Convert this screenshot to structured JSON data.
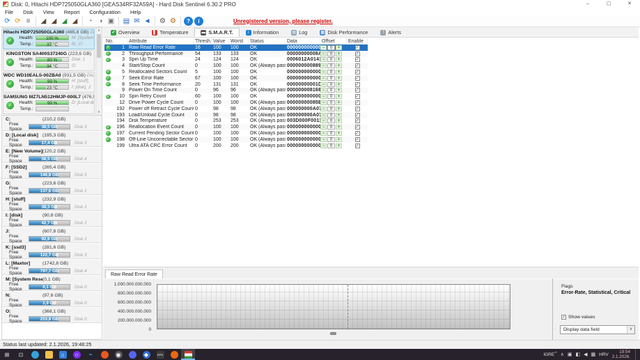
{
  "window": {
    "title": "Disk: 0, Hitachi HDP725050GLA360 [GEAS34RF32A59A]  -  Hard Disk Sentinel 6.30.2 PRO",
    "controls": [
      {
        "name": "minimize",
        "glyph": "–"
      },
      {
        "name": "maximize",
        "glyph": "▢"
      },
      {
        "name": "close",
        "glyph": "✕"
      }
    ]
  },
  "menu": [
    "File",
    "Disk",
    "View",
    "Report",
    "Configuration",
    "Help"
  ],
  "toolbar": {
    "register_notice": "Unregistered version, please register.",
    "icons": [
      {
        "name": "refresh-icon",
        "glyph": "⟳",
        "color": "#1d7fd6"
      },
      {
        "name": "refresh-all-icon",
        "glyph": "⟳",
        "color": "#e8920c"
      },
      {
        "name": "surface-list-icon",
        "glyph": "≡",
        "color": "#666"
      },
      {
        "name": "drive-rescan-icon",
        "glyph": "◢",
        "color": "#5a4632"
      },
      {
        "name": "drive-remove-icon",
        "glyph": "◢",
        "color": "#5a4632"
      },
      {
        "name": "drive-accept-icon",
        "glyph": "◢",
        "color": "#2f8a3a"
      },
      {
        "name": "drive-search-icon",
        "glyph": "◢",
        "color": "#5a4632"
      },
      {
        "name": "disk-clock-icon",
        "glyph": "◔",
        "color": "#5b7d99"
      },
      {
        "name": "disk-status-icon",
        "glyph": "◑",
        "color": "#5b7d99"
      },
      {
        "name": "printer-icon",
        "glyph": "▣",
        "color": "#777777"
      },
      {
        "name": "report-notebook-icon",
        "glyph": "▤",
        "color": "#2f6fbf"
      },
      {
        "name": "mail-icon",
        "glyph": "✉",
        "color": "#2f6fbf"
      },
      {
        "name": "message-icon",
        "glyph": "◄",
        "color": "#2f6fbf"
      },
      {
        "name": "settings-gear-icon",
        "glyph": "⚙",
        "color": "#555555"
      },
      {
        "name": "advanced-gear-icon",
        "glyph": "⚙",
        "color": "#b06a10"
      },
      {
        "name": "help-icon",
        "glyph": "?",
        "color": "#1d7fd6",
        "circle": true
      },
      {
        "name": "info-icon",
        "glyph": "i",
        "color": "#1d7fd6",
        "circle": true
      }
    ]
  },
  "sidebar": {
    "health_label": "Health:",
    "temp_label": "Temp.:",
    "free_space_label": "Free Space",
    "scroll_up": "∧",
    "scroll_down": "∨",
    "status_check": "✓",
    "disks": [
      {
        "name": "Hitachi HDP725050GLA360",
        "size": "(465,8 GB)",
        "disk_label": "Disk 0",
        "health": "100 %",
        "health_fill": 100,
        "temp": "37 °C",
        "temp_fill": 50,
        "right1": "M: [System Rese",
        "right2": "N:, O:",
        "selected": true
      },
      {
        "name": "KINGSTON SA400S37240G",
        "size": "(223,6 GB)",
        "disk_label": "",
        "health": "80 %",
        "health_fill": 80,
        "temp": "34 °C",
        "temp_fill": 45,
        "right1": "Disk: 1",
        "right2": "G:",
        "selected": false
      },
      {
        "name": "WDC WD10EALS-00ZBA0",
        "size": "(931,5 GB)",
        "disk_label": "Disk 2",
        "health": "99 %",
        "health_fill": 99,
        "temp": "23 °C",
        "temp_fill": 31,
        "right1": "H: [stuff],",
        "right2": "I: [disk], J:",
        "selected": false
      },
      {
        "name": "SAMSUNG MZ7LN512HMJP-000L7",
        "size": "(476,9 GB)",
        "disk_label": "",
        "health": "99 %",
        "health_fill": 99,
        "temp": "",
        "temp_fill": 0,
        "right1": "D: [Local disk]",
        "right2": "",
        "selected": false
      }
    ],
    "partitions": [
      {
        "letter": "C:",
        "size": "(210,2 GB)",
        "free": "38,5 GB",
        "fill": 67,
        "disk": "Disk 3"
      },
      {
        "letter": "D: [Local disk]",
        "size": "(195,3 GB)",
        "free": "17,4 GB",
        "fill": 62,
        "disk": "Disk 3"
      },
      {
        "letter": "E: [New Volume]",
        "size": "(120,2 GB)",
        "free": "58,5 GB",
        "fill": 67,
        "disk": "Disk 4"
      },
      {
        "letter": "F: [SSD2]",
        "size": "(265,4 GB)",
        "free": "146,8 GB",
        "fill": 72,
        "disk": "Disk 5"
      },
      {
        "letter": "G:",
        "size": "(223,6 GB)",
        "free": "137,6 GB",
        "fill": 72,
        "disk": "Disk 1"
      },
      {
        "letter": "H: [stuff]",
        "size": "(232,9 GB)",
        "free": "38,3 GB",
        "fill": 62,
        "disk": "Disk 2"
      },
      {
        "letter": "I: [disk]",
        "size": "(90,8 GB)",
        "free": "42,7 GB",
        "fill": 60,
        "disk": "Disk 2"
      },
      {
        "letter": "J:",
        "size": "(607,8 GB)",
        "free": "92,6 GB",
        "fill": 68,
        "disk": "Disk 2"
      },
      {
        "letter": "K: [ssd3]",
        "size": "(281,6 GB)",
        "free": "122,7 GB",
        "fill": 68,
        "disk": "Disk 3"
      },
      {
        "letter": "L: [Maxtor]",
        "size": "(1742,8 GB)",
        "free": "797,7 GB",
        "fill": 70,
        "disk": "Disk 4"
      },
      {
        "letter": "M: [System Rese...]",
        "size": "(0,1 GB)",
        "free": "0,1 GB",
        "fill": 55,
        "disk": "Disk 0"
      },
      {
        "letter": "N:",
        "size": "(97,6 GB)",
        "free": "1,9 GB",
        "fill": 55,
        "disk": "Disk 0"
      },
      {
        "letter": "O:",
        "size": "(368,1 GB)",
        "free": "253,8 GB",
        "fill": 73,
        "disk": "Disk 0"
      }
    ]
  },
  "tabs": [
    {
      "label": "Overview",
      "icon": "check-circle-icon",
      "glyph": "✔",
      "color": "#2daa3f",
      "active": false
    },
    {
      "label": "Temperature",
      "icon": "thermometer-icon",
      "glyph": "▌",
      "color": "#d23b2e",
      "active": false
    },
    {
      "label": "S.M.A.R.T.",
      "icon": "smart-icon",
      "glyph": "▬",
      "color": "#555555",
      "active": true
    },
    {
      "label": "Information",
      "icon": "info-circle-icon",
      "glyph": "i",
      "color": "#1d7fd6",
      "active": false
    },
    {
      "label": "Log",
      "icon": "page-icon",
      "glyph": "▤",
      "color": "#8aa4b8",
      "active": false
    },
    {
      "label": "Disk Performance",
      "icon": "chart-icon",
      "glyph": "▦",
      "color": "#5b8dd6",
      "active": false
    },
    {
      "label": "Alerts",
      "icon": "bell-icon",
      "glyph": "!",
      "color": "#9aa4ac",
      "active": false
    }
  ],
  "smart_table": {
    "columns": [
      "No.",
      "Attribute",
      "Thresh...",
      "Value",
      "Worst",
      "Status",
      "Data",
      "Offset",
      "Enable"
    ],
    "offset_minus": "−",
    "offset_plus": "+",
    "check_glyph": "✓",
    "rows": [
      {
        "no": "1",
        "flagged": true,
        "attribute": "Raw Read Error Rate",
        "thresh": "16",
        "value": "100",
        "worst": "100",
        "status": "OK",
        "data": "000000000000",
        "offset": "0",
        "enabled": true,
        "selected": true
      },
      {
        "no": "2",
        "flagged": true,
        "attribute": "Throughput Performance",
        "thresh": "54",
        "value": "133",
        "worst": "133",
        "status": "OK",
        "data": "00000000008A",
        "offset": "0",
        "enabled": true
      },
      {
        "no": "3",
        "flagged": true,
        "attribute": "Spin Up Time",
        "thresh": "24",
        "value": "124",
        "worst": "124",
        "status": "OK",
        "data": "0006012A0141",
        "offset": "0",
        "enabled": true
      },
      {
        "no": "4",
        "flagged": false,
        "attribute": "Start/Stop Count",
        "thresh": "0",
        "value": "100",
        "worst": "100",
        "status": "OK (Always passing)",
        "data": "000000000889",
        "offset": "0",
        "enabled": true
      },
      {
        "no": "5",
        "flagged": true,
        "attribute": "Reallocated Sectors Count",
        "thresh": "5",
        "value": "100",
        "worst": "100",
        "status": "OK",
        "data": "000000000000",
        "offset": "0",
        "enabled": true
      },
      {
        "no": "7",
        "flagged": true,
        "attribute": "Seek Error Rate",
        "thresh": "67",
        "value": "100",
        "worst": "100",
        "status": "OK",
        "data": "000000000000",
        "offset": "0",
        "enabled": true
      },
      {
        "no": "8",
        "flagged": true,
        "attribute": "Seek Time Performance",
        "thresh": "20",
        "value": "131",
        "worst": "131",
        "status": "OK",
        "data": "00000000001D",
        "offset": "0",
        "enabled": true
      },
      {
        "no": "9",
        "flagged": false,
        "attribute": "Power On Time Count",
        "thresh": "0",
        "value": "96",
        "worst": "96",
        "status": "OK (Always passing)",
        "data": "000000008168",
        "offset": "0",
        "enabled": true
      },
      {
        "no": "10",
        "flagged": true,
        "attribute": "Spin Retry Count",
        "thresh": "60",
        "value": "100",
        "worst": "100",
        "status": "OK",
        "data": "000000000000",
        "offset": "0",
        "enabled": true
      },
      {
        "no": "12",
        "flagged": false,
        "attribute": "Drive Power Cycle Count",
        "thresh": "0",
        "value": "100",
        "worst": "100",
        "status": "OK (Always passing)",
        "data": "00000000085E",
        "offset": "0",
        "enabled": true
      },
      {
        "no": "192",
        "flagged": false,
        "attribute": "Power off Retract Cycle Count",
        "thresh": "0",
        "value": "98",
        "worst": "98",
        "status": "OK (Always passing)",
        "data": "000000000A07",
        "offset": "0",
        "enabled": true
      },
      {
        "no": "193",
        "flagged": false,
        "attribute": "Load/Unload Cycle Count",
        "thresh": "0",
        "value": "98",
        "worst": "98",
        "status": "OK (Always passing)",
        "data": "000000000A07",
        "offset": "0",
        "enabled": true
      },
      {
        "no": "194",
        "flagged": false,
        "attribute": "Disk Temperature",
        "thresh": "0",
        "value": "253",
        "worst": "253",
        "status": "OK (Always passing)",
        "data": "003D000F0011",
        "offset": "0",
        "enabled": true
      },
      {
        "no": "196",
        "flagged": true,
        "attribute": "Reallocation Event Count",
        "thresh": "0",
        "value": "100",
        "worst": "100",
        "status": "OK (Always passing)",
        "data": "000000000000",
        "offset": "0",
        "enabled": true
      },
      {
        "no": "197",
        "flagged": true,
        "attribute": "Current Pending Sector Count",
        "thresh": "0",
        "value": "100",
        "worst": "100",
        "status": "OK (Always passing)",
        "data": "000000000000",
        "offset": "0",
        "enabled": true
      },
      {
        "no": "198",
        "flagged": true,
        "attribute": "Off-Line Uncorrectable Sector Count",
        "thresh": "0",
        "value": "100",
        "worst": "100",
        "status": "OK (Always passing)",
        "data": "000000000000",
        "offset": "0",
        "enabled": true
      },
      {
        "no": "199",
        "flagged": false,
        "attribute": "Ultra ATA CRC Error Count",
        "thresh": "0",
        "value": "200",
        "worst": "200",
        "status": "OK (Always passing)",
        "data": "000000000000",
        "offset": "0",
        "enabled": true
      }
    ]
  },
  "chart": {
    "tab": "Raw Read Error Rate",
    "y_ticks": [
      "1.000.000.000.000",
      "800.000.000.000",
      "600.000.000.000",
      "400.000.000.000",
      "200.000.000.000",
      "0"
    ]
  },
  "chart_data": {
    "type": "line",
    "title": "Raw Read Error Rate",
    "series": [
      {
        "name": "Raw Read Error Rate",
        "values": [
          0
        ]
      }
    ],
    "ylim": [
      0,
      1000000000000
    ],
    "y_tick_step": 200000000000,
    "grid": true,
    "legend_position": "none"
  },
  "flags": {
    "label": "Flags",
    "value": "Error-Rate, Statistical, Critical",
    "show_values_label": "Show values",
    "show_values_checked": true,
    "dropdown": "Display data field",
    "dropdown_arrow": "∨"
  },
  "status_bar": {
    "text": "Status last updated: 2.1.2026, 19:48:25"
  },
  "taskbar": {
    "apps": [
      {
        "name": "start-button",
        "glyph": "⊞",
        "color": "transparent",
        "fg": "#e8eef4",
        "square": true
      },
      {
        "name": "task-view-button",
        "glyph": "⊡",
        "color": "transparent",
        "fg": "#cfd6dd",
        "square": true
      },
      {
        "name": "edge-app",
        "glyph": "",
        "color": "#35a3d8"
      },
      {
        "name": "file-explorer-app",
        "glyph": "",
        "color": "#f0c04a",
        "square": true
      },
      {
        "name": "store-app",
        "glyph": "⌂",
        "color": "#2f7fd4",
        "square": true
      },
      {
        "name": "purple-ring-app",
        "glyph": "○",
        "color": "#7b2ff0"
      },
      {
        "name": "dark-swoosh-app",
        "glyph": "~",
        "color": "#1b2735"
      },
      {
        "name": "orange-flame-app",
        "glyph": "",
        "color": "#e85a1e"
      },
      {
        "name": "lens-app",
        "glyph": "◉",
        "color": "#555555"
      },
      {
        "name": "discord-app",
        "glyph": "",
        "color": "#5865f2"
      },
      {
        "name": "blue-cloud-app",
        "glyph": "◆",
        "color": "#2f6fd4"
      },
      {
        "name": "eps-app",
        "glyph": "EPS",
        "color": "#3a3a3a",
        "square": true,
        "tiny": true
      },
      {
        "name": "firefox-app",
        "glyph": "",
        "color": "#e86a10"
      },
      {
        "name": "hdsentinel-app",
        "glyph": "",
        "color": "flag",
        "active": true,
        "square": true
      }
    ],
    "tray": {
      "toolbar_label": "IGRE",
      "toolbar_marks": "**",
      "chevron": "∧",
      "icons": [
        {
          "name": "tray-app1-icon",
          "glyph": "▣"
        },
        {
          "name": "tray-chat-icon",
          "glyph": "◧"
        },
        {
          "name": "tray-volume-icon",
          "glyph": "◀"
        },
        {
          "name": "tray-network-icon",
          "glyph": "▦"
        }
      ],
      "language": "HRV",
      "time": "19:54",
      "date": "2.1.2026."
    }
  }
}
